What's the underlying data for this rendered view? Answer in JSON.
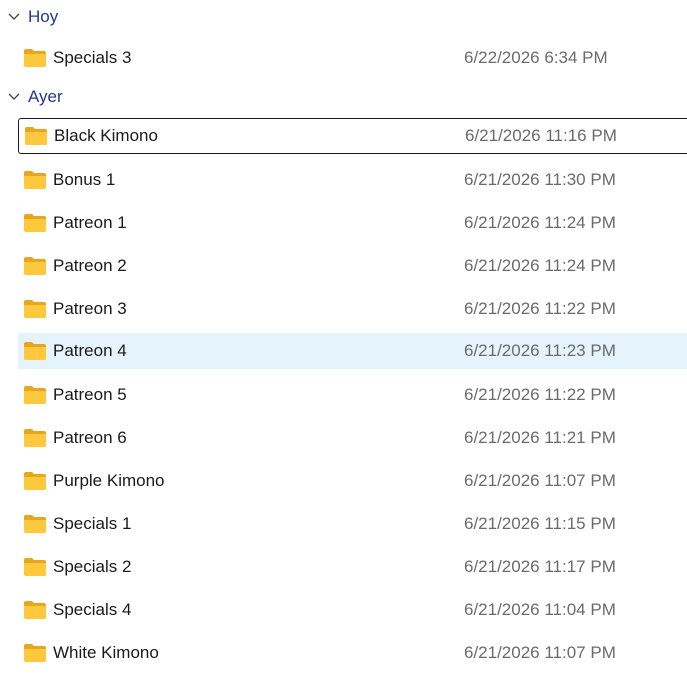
{
  "groups": [
    {
      "title": "Hoy",
      "items": [
        {
          "name": "Specials 3",
          "date": "6/22/2026 6:34 PM"
        }
      ]
    },
    {
      "title": "Ayer",
      "items": [
        {
          "name": "Black Kimono",
          "date": "6/21/2026 11:16 PM"
        },
        {
          "name": "Bonus 1",
          "date": "6/21/2026 11:30 PM"
        },
        {
          "name": "Patreon 1",
          "date": "6/21/2026 11:24 PM"
        },
        {
          "name": "Patreon 2",
          "date": "6/21/2026 11:24 PM"
        },
        {
          "name": "Patreon 3",
          "date": "6/21/2026 11:22 PM"
        },
        {
          "name": "Patreon 4",
          "date": "6/21/2026 11:23 PM"
        },
        {
          "name": "Patreon 5",
          "date": "6/21/2026 11:22 PM"
        },
        {
          "name": "Patreon 6",
          "date": "6/21/2026 11:21 PM"
        },
        {
          "name": "Purple Kimono",
          "date": "6/21/2026 11:07 PM"
        },
        {
          "name": "Specials 1",
          "date": "6/21/2026 11:15 PM"
        },
        {
          "name": "Specials 2",
          "date": "6/21/2026 11:17 PM"
        },
        {
          "name": "Specials 4",
          "date": "6/21/2026 11:04 PM"
        },
        {
          "name": "White Kimono",
          "date": "6/21/2026 11:07 PM"
        }
      ]
    }
  ],
  "icons": {
    "folder": "folder-icon",
    "chevron": "chevron-down-icon"
  },
  "colors": {
    "group_title": "#1f3a93",
    "hover_background": "#e5f3fd",
    "date_text": "#6b6b6b",
    "folder_front": "#ffc83d",
    "folder_back": "#e8a620"
  }
}
